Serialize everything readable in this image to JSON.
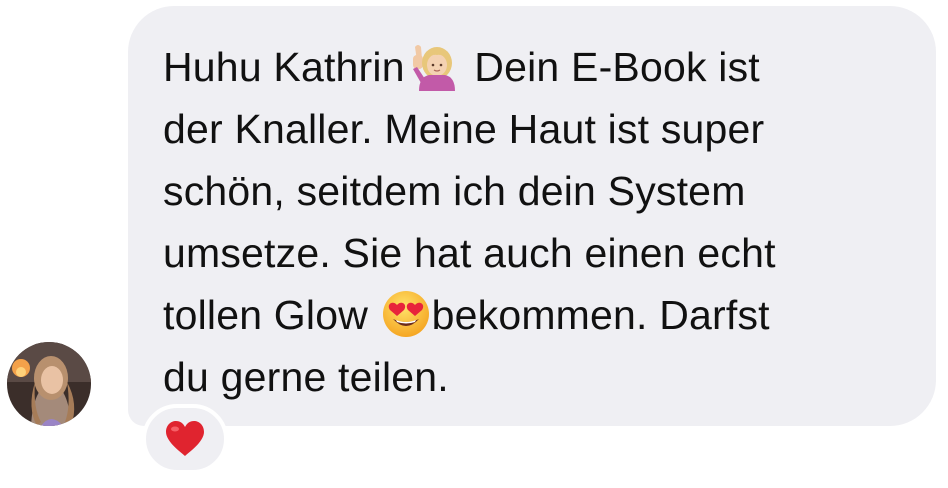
{
  "message": {
    "lines": {
      "l1a": "Huhu Kathrin",
      "l1b": " Dein E-Book ist",
      "l2": "der Knaller. Meine Haut ist super",
      "l3": "schön, seitdem ich dein System",
      "l4": "umsetze. Sie hat auch einen echt",
      "l5a": "tollen Glow ",
      "l5b": "bekommen. Darfst",
      "l6": "du gerne teilen."
    },
    "emoji_1": "person-raising-hand-emoji",
    "emoji_2": "heart-eyes-emoji"
  },
  "sender": {
    "avatar": "profile-photo-avatar"
  },
  "reaction": {
    "icon": "red-heart-icon",
    "color": "#e0242f"
  },
  "colors": {
    "bubble": "#efeff3",
    "text": "#111111",
    "background": "#ffffff"
  }
}
